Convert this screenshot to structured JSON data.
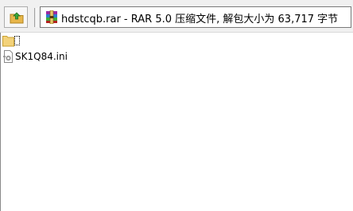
{
  "address": {
    "text": "hdstcqb.rar - RAR 5.0 压缩文件, 解包大小为 63,717 字节",
    "icon": "winrar-archive-icon"
  },
  "toolbar": {
    "up_icon": "up-folder-icon"
  },
  "files": [
    {
      "name": "..",
      "icon": "folder-icon"
    },
    {
      "name": "SK1Q84.ini",
      "icon": "settings-file-icon"
    }
  ]
}
